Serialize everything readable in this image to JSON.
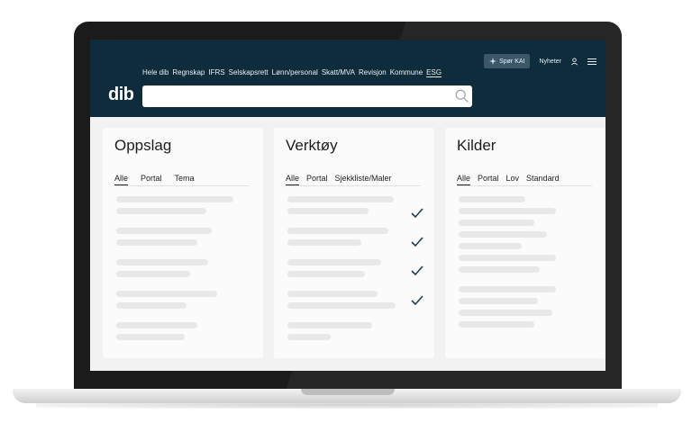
{
  "header": {
    "ask_label": "Spør KAI",
    "news_label": "Nyheter",
    "logo": "dib",
    "nav": [
      "Hele dib",
      "Regnskap",
      "IFRS",
      "Selskapsrett",
      "Lønn/personal",
      "Skatt/MVA",
      "Revisjon",
      "Kommune",
      "ESG"
    ],
    "active_nav": "ESG",
    "search": {
      "value": "",
      "placeholder": ""
    },
    "icons": [
      "sparkle-icon",
      "user-icon",
      "menu-icon",
      "search-icon"
    ]
  },
  "columns": [
    {
      "title": "Oppslag",
      "tabs": [
        "Alle",
        "Portal",
        "Tema"
      ],
      "active_tab": "Alle"
    },
    {
      "title": "Verktøy",
      "tabs": [
        "Alle",
        "Portal",
        "Sjekkliste/Maler"
      ],
      "active_tab": "Alle",
      "row_icons": [
        "check-icon",
        "check-icon",
        "check-icon",
        "check-icon"
      ]
    },
    {
      "title": "Kilder",
      "tabs": [
        "Alle",
        "Portal",
        "Lov",
        "Standard"
      ],
      "active_tab": "Alle"
    }
  ],
  "colors": {
    "header_bg": "#0f2c3c",
    "screen_bg": "#f2f2f2",
    "card_bg": "#fbfbfb",
    "placeholder": "#e8e8e8",
    "check": "#1f3f52"
  }
}
